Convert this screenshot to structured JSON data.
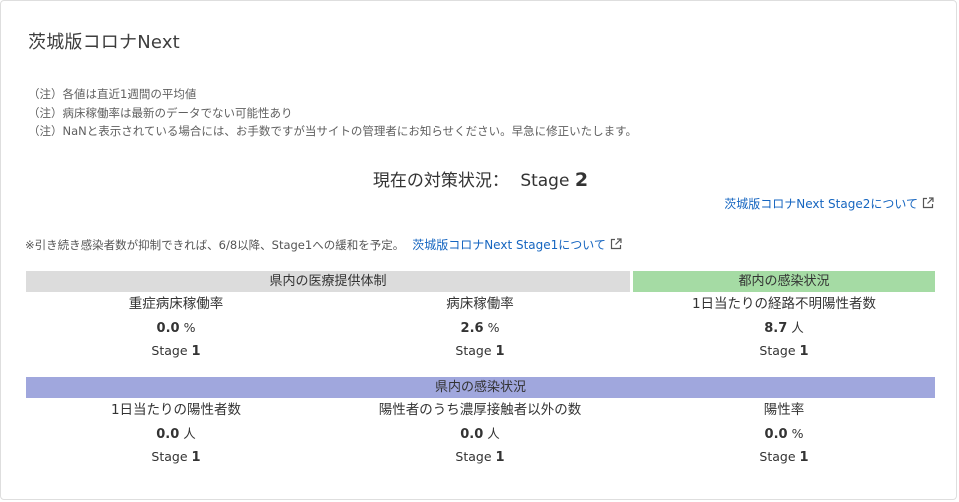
{
  "title": "茨城版コロナNext",
  "notes": [
    "（注）各値は直近1週間の平均値",
    "（注）病床稼働率は最新のデータでない可能性あり",
    "（注）NaNと表示されている場合には、お手数ですが当サイトの管理者にお知らせください。早急に修正いたします。"
  ],
  "current_status": {
    "label": "現在の対策状況：",
    "stage_word": "Stage",
    "stage_number": "2"
  },
  "stage2_link": "茨城版コロナNext Stage2について",
  "plan_note": "※引き続き感染者数が抑制できれば、6/8以降、Stage1への緩和を予定。",
  "stage1_link": "茨城版コロナNext Stage1について",
  "sections": {
    "medical": {
      "header": "県内の医療提供体制",
      "color": "#dcdcdc",
      "items": [
        {
          "label": "重症病床稼働率",
          "value": "0.0",
          "unit": "%",
          "stage_word": "Stage",
          "stage_num": "1"
        },
        {
          "label": "病床稼働率",
          "value": "2.6",
          "unit": "%",
          "stage_word": "Stage",
          "stage_num": "1"
        }
      ]
    },
    "tokyo": {
      "header": "都内の感染状況",
      "color": "#a5dba4",
      "items": [
        {
          "label": "1日当たりの経路不明陽性者数",
          "value": "8.7",
          "unit": "人",
          "stage_word": "Stage",
          "stage_num": "1"
        }
      ]
    },
    "prefecture": {
      "header": "県内の感染状況",
      "color": "#a0a7dd",
      "items": [
        {
          "label": "1日当たりの陽性者数",
          "value": "0.0",
          "unit": "人",
          "stage_word": "Stage",
          "stage_num": "1"
        },
        {
          "label": "陽性者のうち濃厚接触者以外の数",
          "value": "0.0",
          "unit": "人",
          "stage_word": "Stage",
          "stage_num": "1"
        },
        {
          "label": "陽性率",
          "value": "0.0",
          "unit": "%",
          "stage_word": "Stage",
          "stage_num": "1"
        }
      ]
    }
  },
  "icons": {
    "external_link": "external-link-icon"
  },
  "colors": {
    "link": "#1565c0"
  }
}
